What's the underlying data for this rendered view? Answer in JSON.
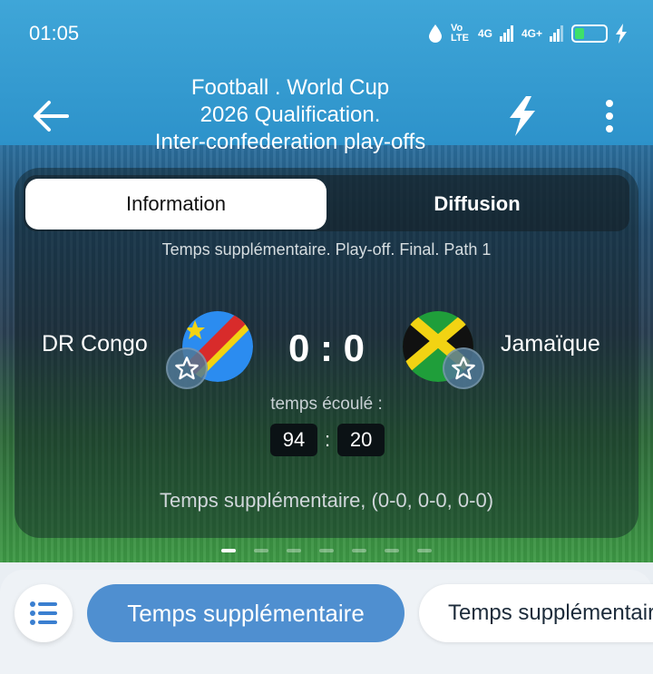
{
  "status_bar": {
    "time": "01:05",
    "network1": "Vo LTE",
    "network2": "4G",
    "network3": "4G+"
  },
  "header": {
    "title_line1": "Football . World Cup",
    "title_line2": "2026 Qualification.",
    "title_line3": "Inter-confederation play-offs"
  },
  "tabs": [
    {
      "label": "Information"
    },
    {
      "label": "Diffusion"
    }
  ],
  "match": {
    "stage": "Temps supplémentaire. Play-off. Final. Path 1",
    "home_team": "DR Congo",
    "away_team": "Jamaïque",
    "score": "0 : 0",
    "elapsed_label": "temps écoulé :",
    "minutes": "94",
    "seconds": "20",
    "clock_separator": ":",
    "period_scores": "Temps supplémentaire, (0-0, 0-0, 0-0)"
  },
  "pager": {
    "count": 7,
    "active": 0
  },
  "bottom_bar": {
    "pill1": "Temps supplémentaire",
    "pill2": "Temps supplémentaire"
  },
  "icons": {
    "back": "arrow-left-icon",
    "bolt": "lightning-icon",
    "more": "more-vertical-icon",
    "star": "star-outline-icon",
    "list": "list-icon"
  }
}
